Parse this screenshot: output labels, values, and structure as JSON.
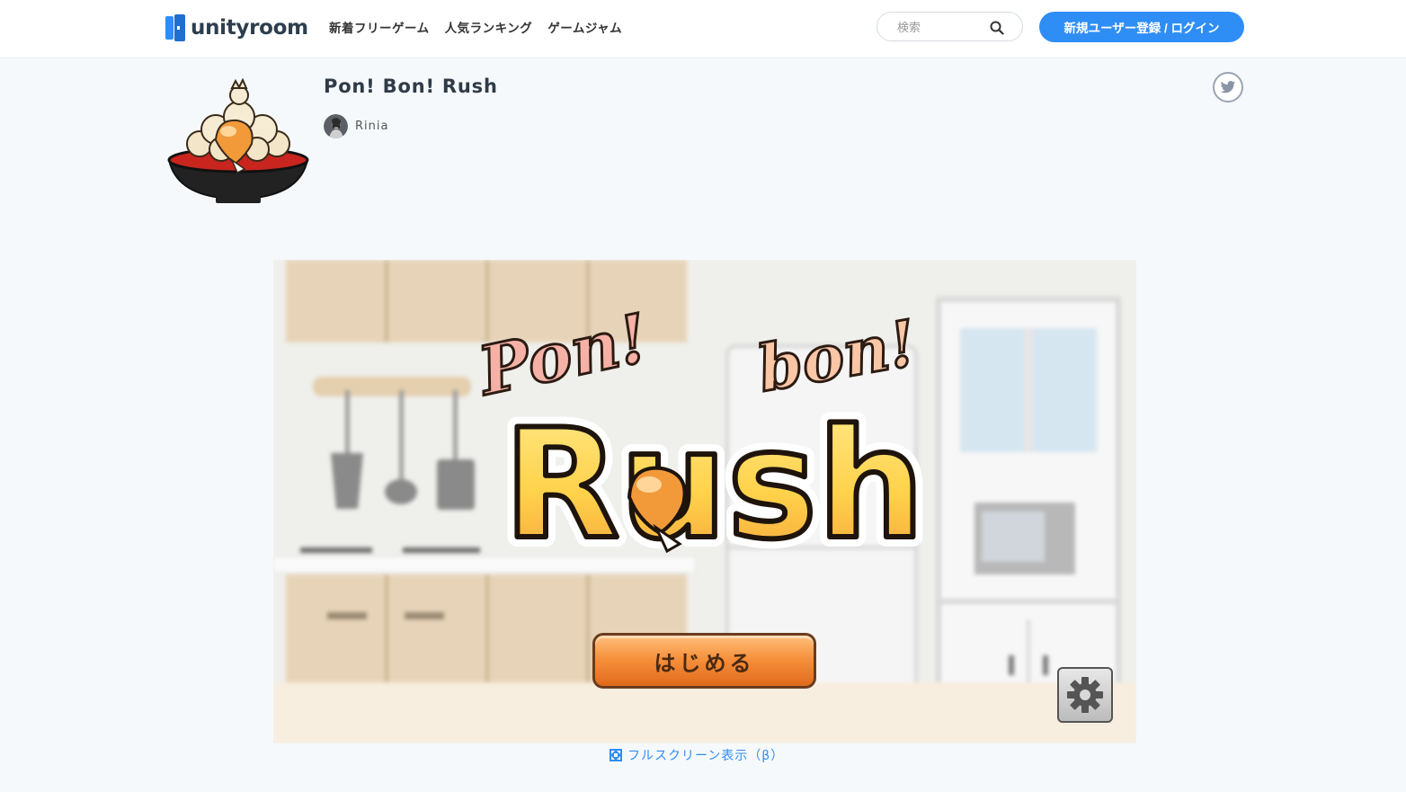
{
  "header": {
    "logo_text": "unityroom",
    "nav": [
      {
        "label": "新着フリーゲーム"
      },
      {
        "label": "人気ランキング"
      },
      {
        "label": "ゲームジャム"
      }
    ],
    "search_placeholder": "検索",
    "login_label": "新規ユーザー登録 / ログイン"
  },
  "game": {
    "title": "Pon! Bon! Rush",
    "author": "Rinia",
    "start_label": "はじめる",
    "fullscreen_label": "フルスクリーン表示（β）"
  },
  "logo_text": {
    "pon": "Pon!",
    "bon": "bon!",
    "rush": "Rush"
  },
  "colors": {
    "accent": "#2f8ef5",
    "start_button": "#f7913c",
    "page_bg": "#f6f9fb"
  },
  "icons": [
    "search-icon",
    "twitter-icon",
    "gear-icon",
    "fullscreen-icon"
  ]
}
